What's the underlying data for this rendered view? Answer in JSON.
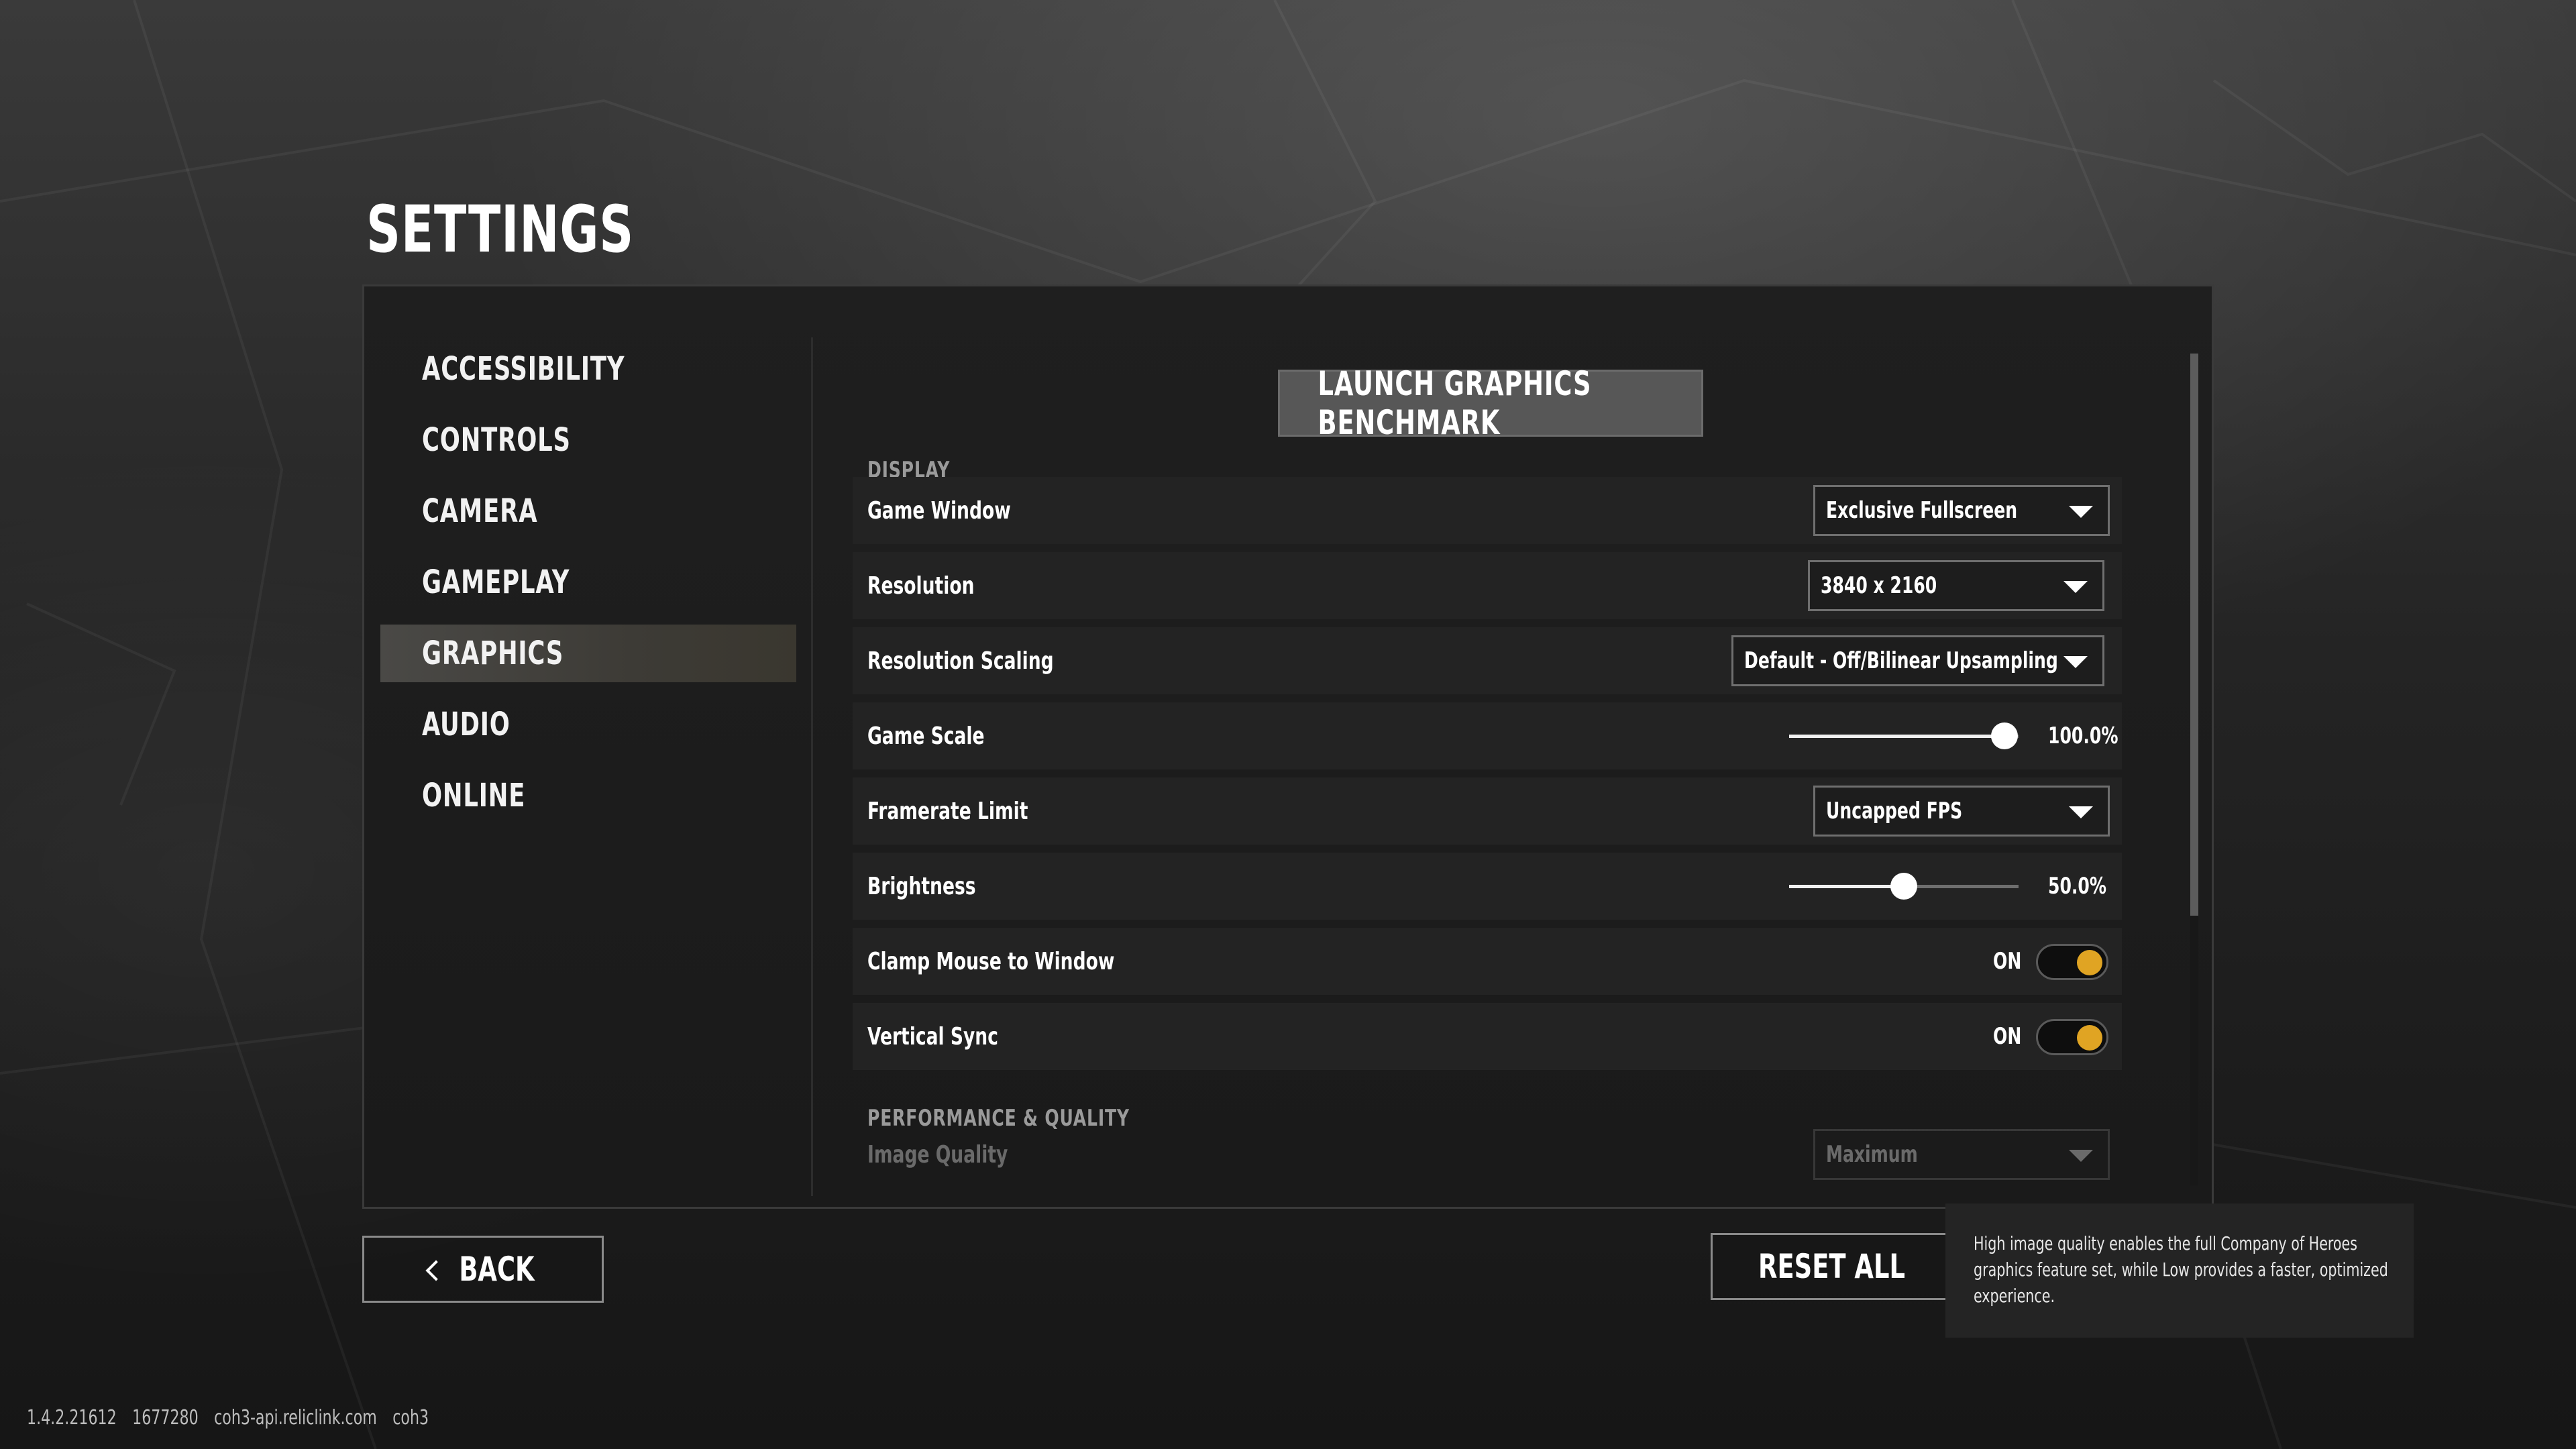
{
  "title": "SETTINGS",
  "nav": {
    "items": [
      {
        "label": "ACCESSIBILITY"
      },
      {
        "label": "CONTROLS"
      },
      {
        "label": "CAMERA"
      },
      {
        "label": "GAMEPLAY"
      },
      {
        "label": "GRAPHICS",
        "active": true
      },
      {
        "label": "AUDIO"
      },
      {
        "label": "ONLINE"
      }
    ]
  },
  "main": {
    "benchmark_label": "LAUNCH GRAPHICS BENCHMARK",
    "sections": {
      "display": "DISPLAY",
      "performance": "PERFORMANCE & QUALITY"
    },
    "settings": {
      "game_window": {
        "label": "Game Window",
        "value": "Exclusive Fullscreen"
      },
      "resolution": {
        "label": "Resolution",
        "value": "3840 x 2160"
      },
      "resolution_scaling": {
        "label": "Resolution Scaling",
        "value": "Default - Off/Bilinear Upsampling"
      },
      "game_scale": {
        "label": "Game Scale",
        "value_text": "100.0%",
        "fraction": 0.94
      },
      "framerate_limit": {
        "label": "Framerate Limit",
        "value": "Uncapped FPS"
      },
      "brightness": {
        "label": "Brightness",
        "value_text": "50.0%",
        "fraction": 0.5
      },
      "clamp_mouse": {
        "label": "Clamp Mouse to Window",
        "state": "ON"
      },
      "vertical_sync": {
        "label": "Vertical Sync",
        "state": "ON"
      },
      "image_quality": {
        "label": "Image Quality",
        "value": "Maximum"
      }
    }
  },
  "buttons": {
    "back": "BACK",
    "reset_all": "RESET ALL"
  },
  "tooltip": {
    "text": "High image quality enables the full Company of Heroes graphics feature set, while Low provides a faster, optimized experience."
  },
  "footer": {
    "version": "1.4.2.21612",
    "build": "1677280",
    "host": "coh3-api.reliclink.com",
    "game": "coh3"
  },
  "colors": {
    "toggle_on": "#e0a423",
    "active_nav": "#4a4946"
  }
}
